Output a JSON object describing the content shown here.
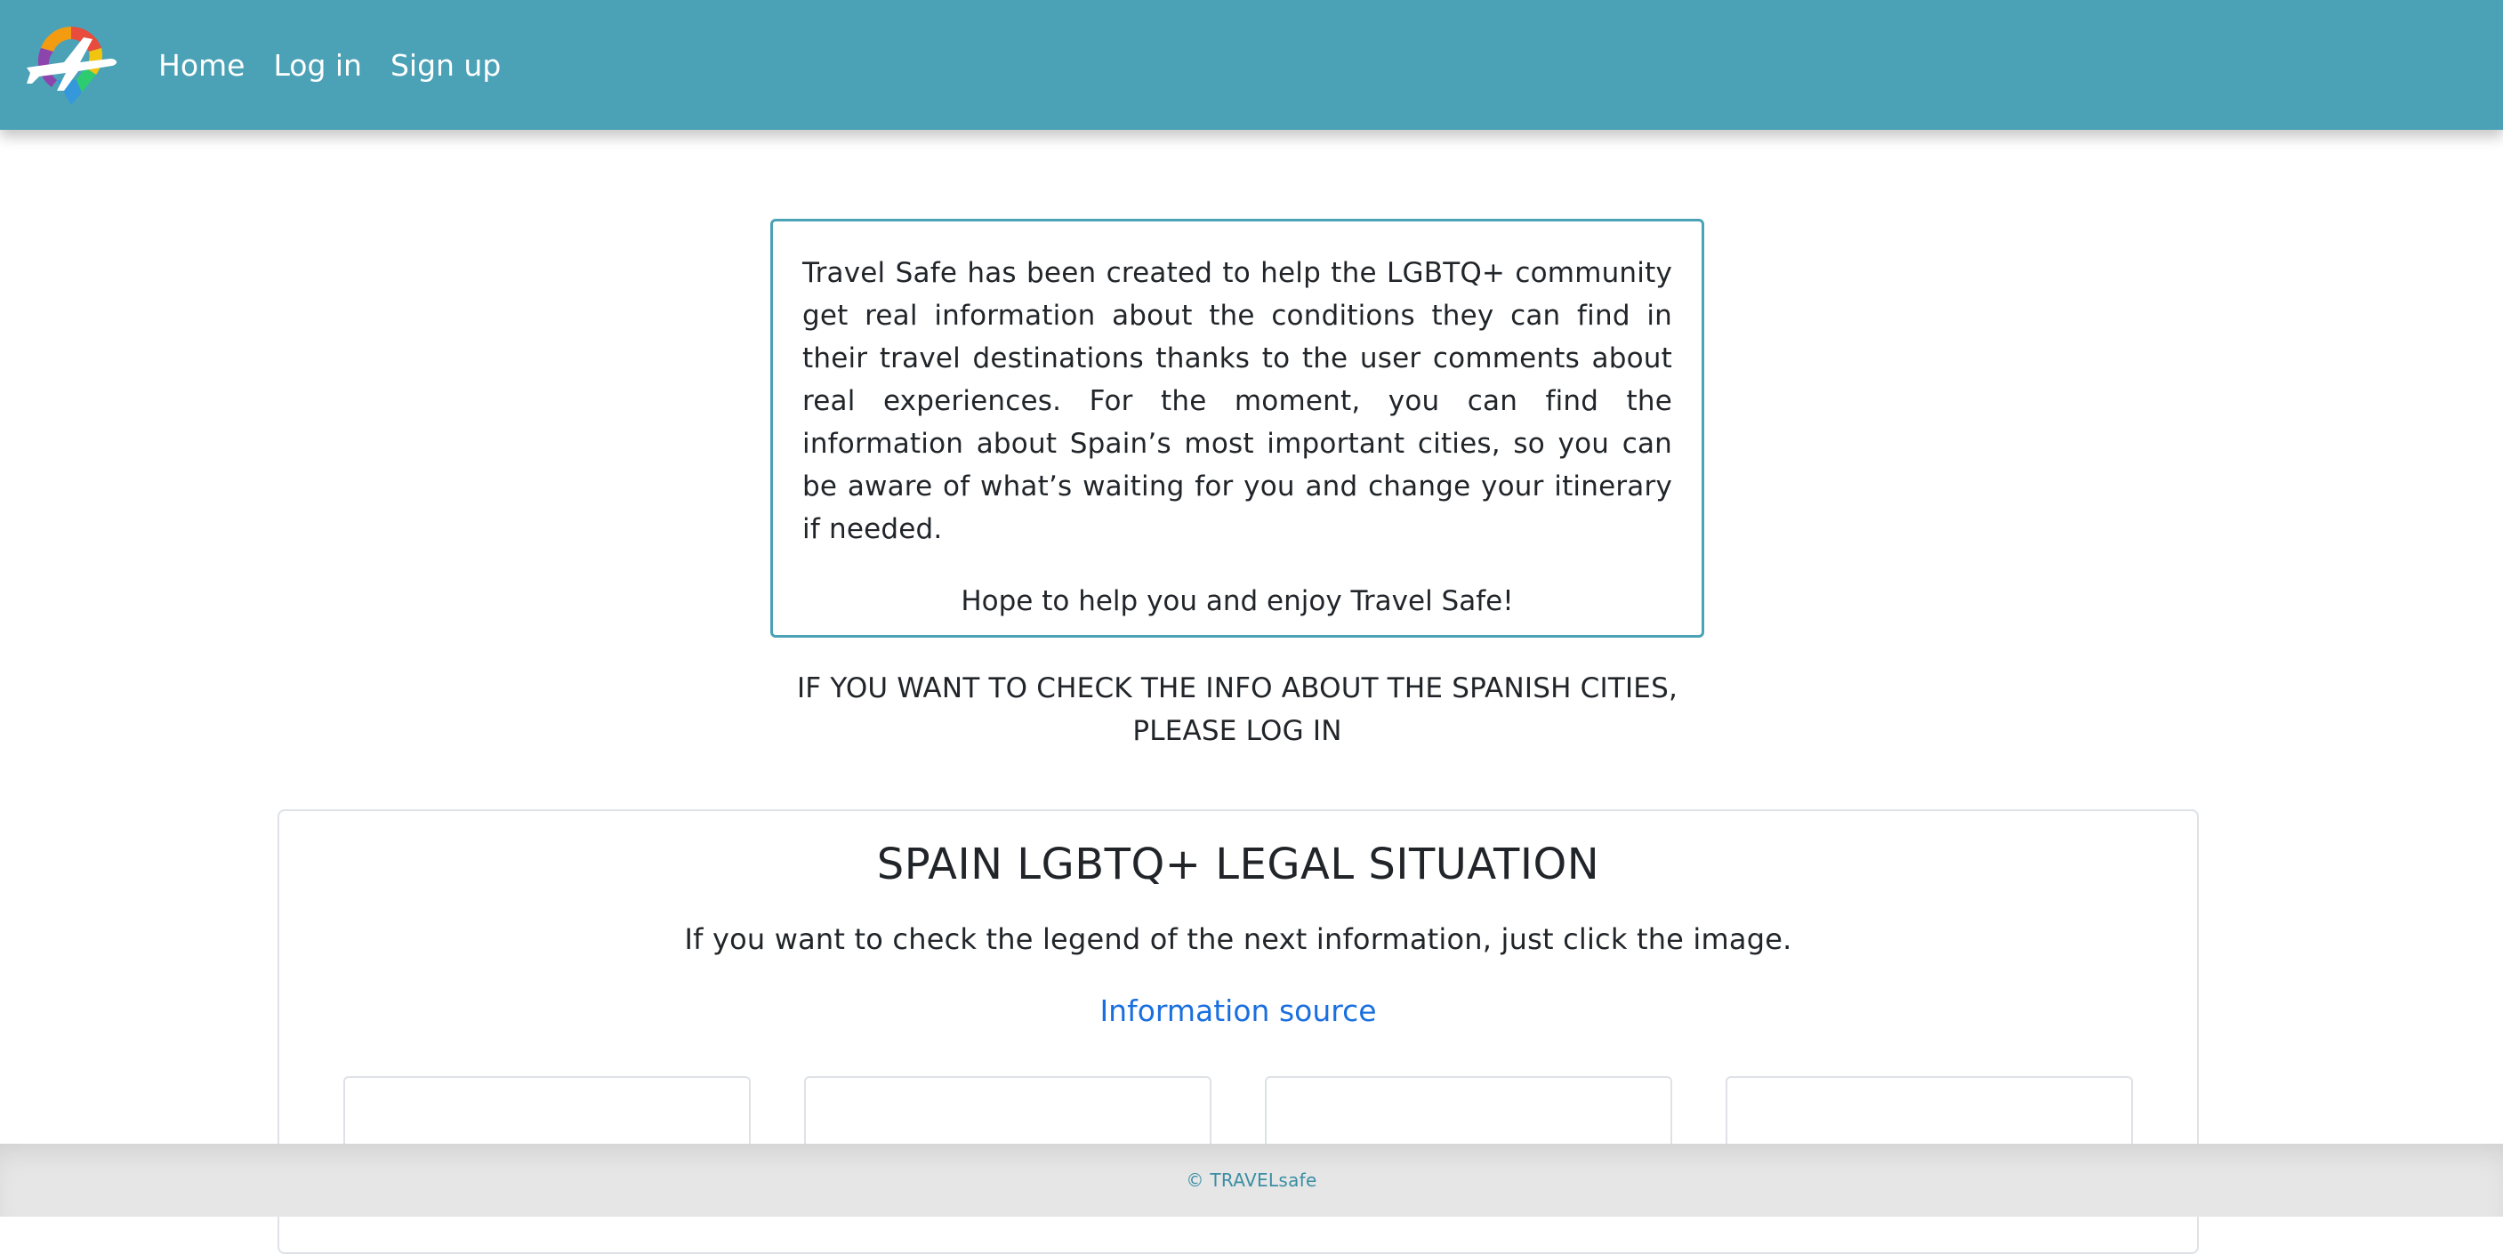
{
  "navbar": {
    "logo_icon": "rainbow-pin-airplane-logo",
    "links": [
      "Home",
      "Log in",
      "Sign up"
    ],
    "color": "#4ba2b6"
  },
  "intro": {
    "text": "Travel Safe has been created to help the LGBTQ+ community get real information about the conditions they can find in their travel destinations thanks to the user comments about real experiences. For the moment, you can find the information about Spain’s most important cities, so you can be aware of what’s waiting for you and change your itinerary if needed.",
    "closing": "Hope to help you and enjoy Travel Safe!"
  },
  "notice": {
    "line1": "IF YOU WANT TO CHECK THE INFO ABOUT THE SPANISH CITIES,",
    "line2": "PLEASE LOG IN"
  },
  "legal": {
    "title": "SPAIN LGBTQ+ LEGAL SITUATION",
    "subtitle": "If you want to check the legend of the next information, just click the image.",
    "source_link": "Information source"
  },
  "footer": {
    "text": "© TRAVELsafe"
  }
}
